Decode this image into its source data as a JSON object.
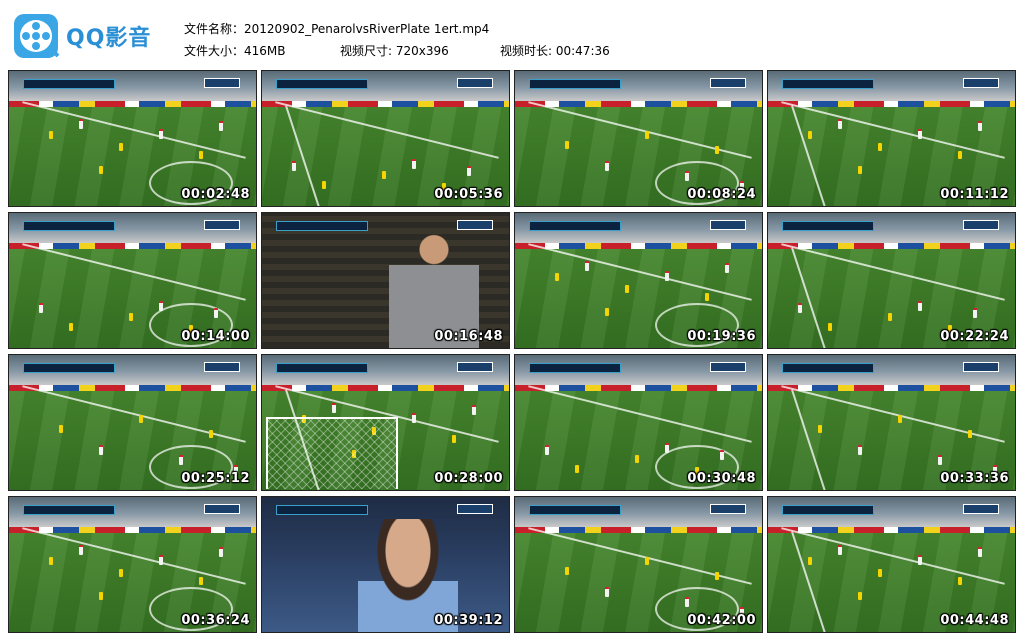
{
  "app": {
    "logo_text": "QQ影音",
    "brand_color": "#2b8fd6"
  },
  "file_info": {
    "name_label": "文件名称：",
    "name_value": "20120902_PenarolvsRiverPlate 1ert.mp4",
    "size_label": "文件大小：",
    "size_value": "416MB",
    "dims_label": "视频尺寸: ",
    "dims_value": "720x396",
    "duration_label": "视频时长: ",
    "duration_value": "00:47:36"
  },
  "thumbnails": [
    {
      "time": "00:02:48",
      "scene": "field"
    },
    {
      "time": "00:05:36",
      "scene": "field"
    },
    {
      "time": "00:08:24",
      "scene": "field"
    },
    {
      "time": "00:11:12",
      "scene": "field"
    },
    {
      "time": "00:14:00",
      "scene": "field"
    },
    {
      "time": "00:16:48",
      "scene": "crowd"
    },
    {
      "time": "00:19:36",
      "scene": "field"
    },
    {
      "time": "00:22:24",
      "scene": "field"
    },
    {
      "time": "00:25:12",
      "scene": "field"
    },
    {
      "time": "00:28:00",
      "scene": "goal"
    },
    {
      "time": "00:30:48",
      "scene": "field"
    },
    {
      "time": "00:33:36",
      "scene": "field"
    },
    {
      "time": "00:36:24",
      "scene": "field"
    },
    {
      "time": "00:39:12",
      "scene": "closeup"
    },
    {
      "time": "00:42:00",
      "scene": "field"
    },
    {
      "time": "00:44:48",
      "scene": "field"
    }
  ],
  "icons": {
    "logo": "film-reel-icon"
  }
}
